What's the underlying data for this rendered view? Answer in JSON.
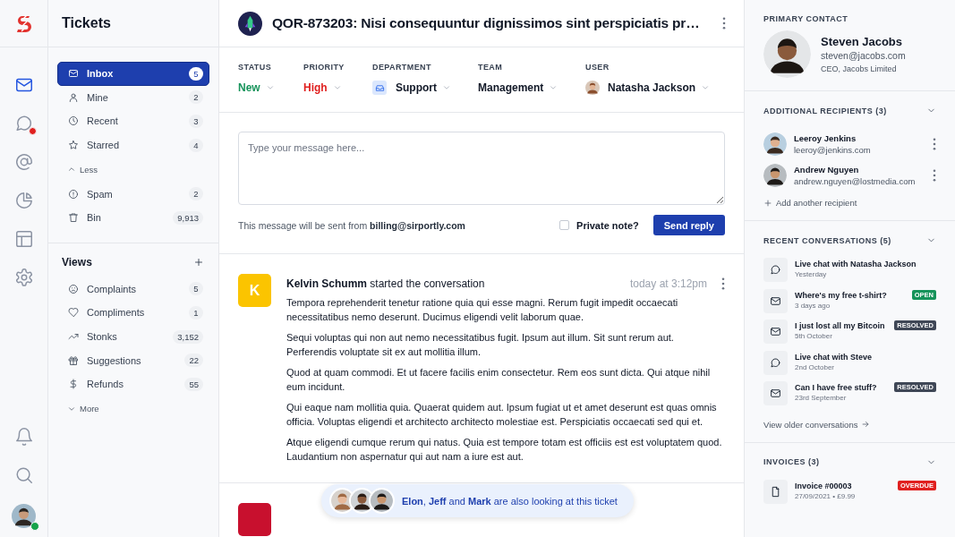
{
  "rail": {
    "items": [
      {
        "selected": true,
        "unread": false
      },
      {
        "selected": false,
        "unread": true
      },
      {
        "selected": false,
        "unread": false
      },
      {
        "selected": false,
        "unread": false
      },
      {
        "selected": false,
        "unread": false
      },
      {
        "selected": false,
        "unread": false
      }
    ],
    "bottom_items": [
      {
        "selected": false
      },
      {
        "selected": false
      }
    ],
    "user_online": true
  },
  "sidebar": {
    "title": "Tickets",
    "folders": [
      {
        "label": "Inbox",
        "count": "5",
        "selected": true
      },
      {
        "label": "Mine",
        "count": "2",
        "selected": false
      },
      {
        "label": "Recent",
        "count": "3",
        "selected": false
      },
      {
        "label": "Starred",
        "count": "4",
        "selected": false
      }
    ],
    "less_toggle": "Less",
    "extra_folders": [
      {
        "label": "Spam",
        "count": "2",
        "selected": false
      },
      {
        "label": "Bin",
        "count": "9,913",
        "selected": false
      }
    ],
    "views_title": "Views",
    "views": [
      {
        "label": "Complaints",
        "count": "5",
        "selected": false
      },
      {
        "label": "Compliments",
        "count": "1",
        "selected": false
      },
      {
        "label": "Stonks",
        "count": "3,152",
        "selected": false
      },
      {
        "label": "Suggestions",
        "count": "22",
        "selected": false
      },
      {
        "label": "Refunds",
        "count": "55",
        "selected": false
      }
    ],
    "more_toggle": "More"
  },
  "ticket": {
    "title": "QOR-873203: Nisi consequuntur dignissimos sint perspiciatis pr…",
    "fields": [
      {
        "label": "STATUS",
        "value": "New",
        "kind": "plain",
        "color": "#16935a"
      },
      {
        "label": "PRIORITY",
        "value": "High",
        "kind": "plain",
        "color": "#e0201f"
      },
      {
        "label": "DEPARTMENT",
        "value": "Support",
        "kind": "icon",
        "color": "#111827"
      },
      {
        "label": "TEAM",
        "value": "Management",
        "kind": "plain",
        "color": "#111827"
      },
      {
        "label": "USER",
        "value": "Natasha Jackson",
        "kind": "avatar",
        "color": "#111827"
      }
    ],
    "composer": {
      "placeholder": "Type your message here...",
      "from_note": "This message will be sent from **billing@sirportly.com**",
      "private_note": {
        "label": "Private note?",
        "checked": false
      },
      "send_button": "Send reply"
    }
  },
  "messages": [
    {
      "initial": "K",
      "color": "#fbc400",
      "author": "Kelvin Schumm",
      "action": "started the conversation",
      "time": "today at 3:12pm",
      "paragraphs": [
        "Tempora reprehenderit tenetur ratione quia qui esse magni. Rerum fugit impedit occaecati necessitatibus nemo deserunt. Ducimus eligendi velit laborum quae.",
        "Sequi voluptas qui non aut nemo necessitatibus fugit. Ipsum aut illum. Sit sunt rerum aut. Perferendis voluptate sit ex aut mollitia illum.",
        "Quod at quam commodi. Et ut facere facilis enim consectetur. Rem eos sunt dicta. Qui atque nihil eum incidunt.",
        "Qui eaque nam mollitia quia. Quaerat quidem aut. Ipsum fugiat ut et amet deserunt est quas omnis officia. Voluptas eligendi et architecto architecto molestiae est. Perspiciatis occaecati sed qui et.",
        "Atque eligendi cumque rerum qui natus. Quia est tempore totam est officiis est est voluptatem quod. Laudantium non aspernatur qui aut nam a iure est aut."
      ]
    },
    {
      "color": "#c8102e"
    }
  ],
  "presence": {
    "text": "**Elon**, **Jeff** and **Mark** are also looking at this ticket"
  },
  "contact_panel": {
    "primary_contact": {
      "heading": "PRIMARY CONTACT",
      "name": "Steven Jacobs",
      "email": "steven@jacobs.com",
      "role": "CEO, Jacobs Limited"
    },
    "recipients": {
      "heading": "ADDITIONAL RECIPIENTS (3)",
      "expanded": true,
      "items": [
        {
          "name": "Leeroy Jenkins",
          "email": "leeroy@jenkins.com"
        },
        {
          "name": "Andrew Nguyen",
          "email": "andrew.nguyen@lostmedia.com"
        }
      ],
      "add_link": "Add another recipient"
    },
    "conversations": {
      "heading": "RECENT CONVERSATIONS (5)",
      "expanded": true,
      "items": [
        {
          "kind": "chat",
          "title": "Live chat with Natasha Jackson",
          "date": "Yesterday"
        },
        {
          "kind": "email",
          "title": "Where's my free t-shirt?",
          "date": "3 days ago",
          "tag": {
            "label": "OPEN",
            "color": "#16935a"
          }
        },
        {
          "kind": "email",
          "title": "I just lost all my Bitcoin",
          "date": "5th October",
          "tag": {
            "label": "RESOLVED",
            "color": "#3f4756"
          }
        },
        {
          "kind": "chat",
          "title": "Live chat with Steve",
          "date": "2nd October"
        },
        {
          "kind": "email",
          "title": "Can I have free stuff?",
          "date": "23rd September",
          "tag": {
            "label": "RESOLVED",
            "color": "#3f4756"
          }
        }
      ],
      "older_link": "View older conversations"
    },
    "invoices": {
      "heading": "INVOICES (3)",
      "expanded": true,
      "items": [
        {
          "title": "Invoice #00003",
          "meta": "27/09/2021 • £9.99",
          "tag": {
            "label": "OVERDUE",
            "color": "#e0201f"
          }
        }
      ]
    }
  }
}
